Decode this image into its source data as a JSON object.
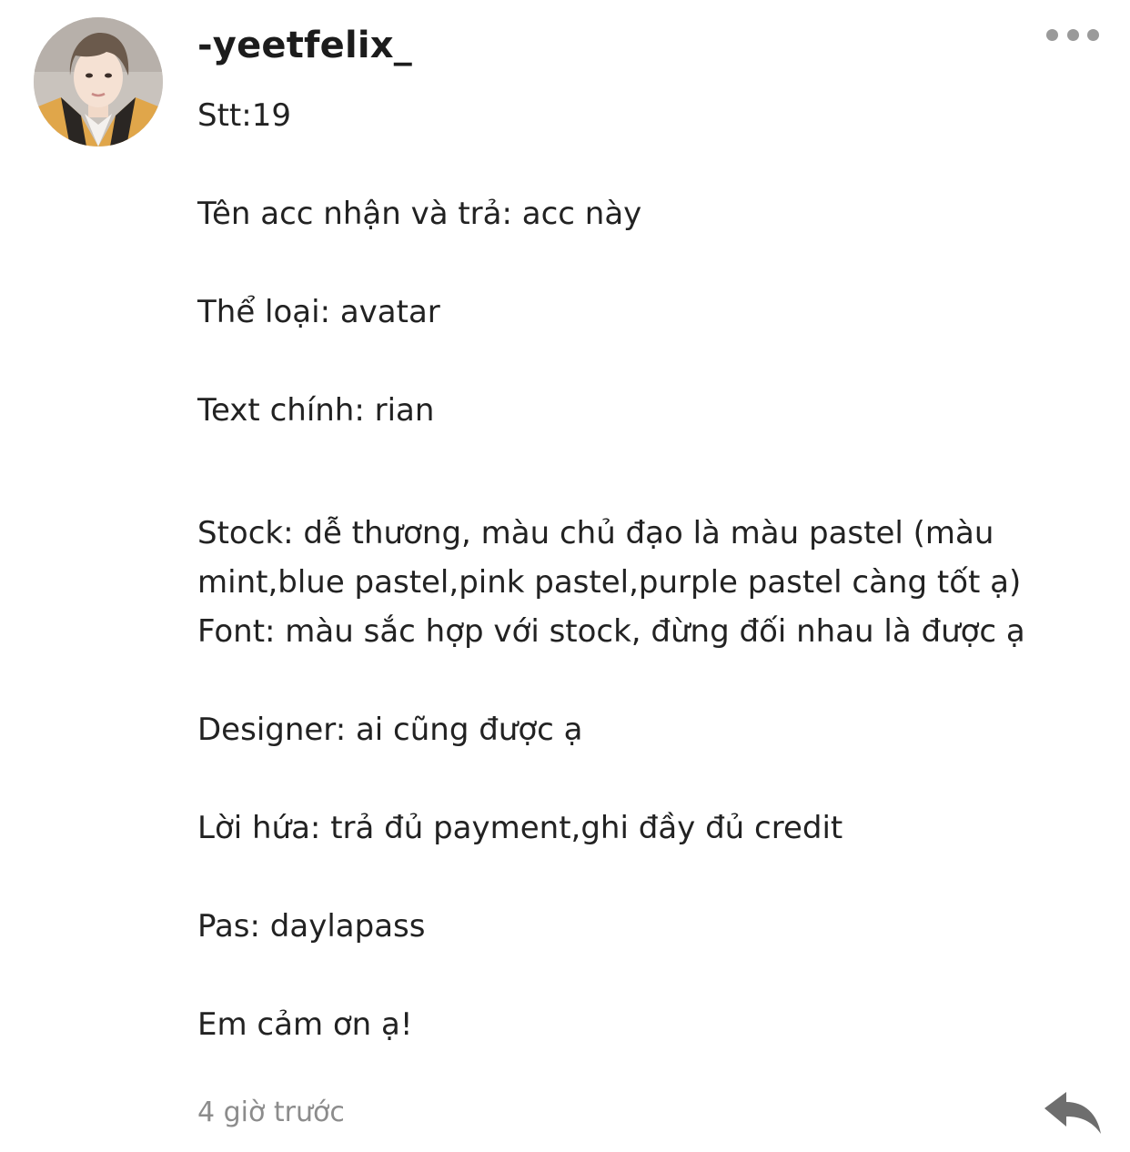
{
  "comment": {
    "username": "-yeetfelix_",
    "lines": [
      "Stt:19",
      "Tên acc nhận và trả: acc này",
      "Thể loại: avatar",
      "Text chính: rian",
      "Stock: dễ thương, màu chủ đạo là màu pastel (màu",
      "mint,blue pastel,pink pastel,purple pastel càng tốt ạ)",
      "Font: màu sắc hợp với stock, đừng đối nhau là được ạ",
      "Designer: ai cũng được ạ",
      "Lời hứa: trả đủ payment,ghi đầy đủ credit",
      "Pas: daylapass",
      "Em cảm ơn ạ!"
    ],
    "timestamp": "4 giờ trước"
  },
  "icons": {
    "avatar": "profile-photo",
    "more": "more-horizontal-icon",
    "reply": "reply-arrow-icon"
  },
  "colors": {
    "text": "#222222",
    "timestamp": "#8c8c8c",
    "icon": "#9a9a9a",
    "reply_icon": "#6e6e6e"
  }
}
